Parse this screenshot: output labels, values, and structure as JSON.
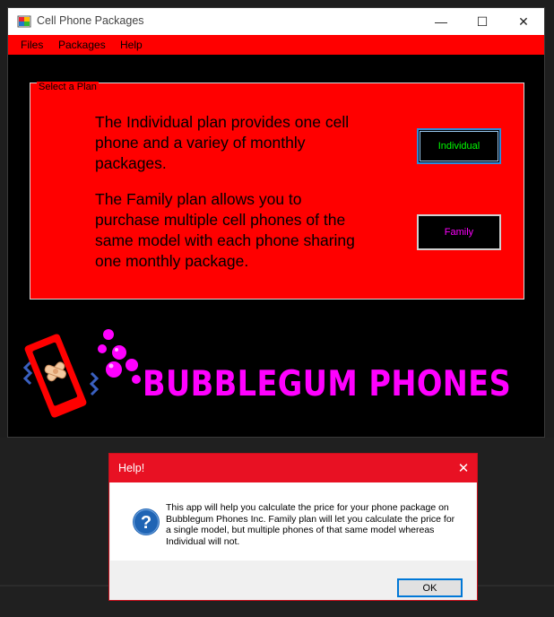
{
  "window": {
    "title": "Cell Phone Packages",
    "controls": {
      "minimize": "—",
      "maximize": "☐",
      "close": "✕"
    }
  },
  "menu": {
    "files": "Files",
    "packages": "Packages",
    "help": "Help"
  },
  "plan_group": {
    "label": "Select a Plan",
    "individual_text": "The Individual plan provides one cell phone and a variey of monthly packages.",
    "family_text": "The Family plan allows you to purchase multiple cell phones of the same model with each phone sharing one monthly package.",
    "individual_button": "Individual",
    "family_button": "Family"
  },
  "logo": {
    "brand": "BUBBLEGUM PHONES"
  },
  "dialog": {
    "title": "Help!",
    "close": "✕",
    "icon": "question-icon",
    "message": "This app will help you calculate the price for your phone package on Bubblegum Phones Inc. Family plan will let you calculate the price for a single model, but multiple phones of that same model whereas Individual will not.",
    "ok_button": "OK"
  },
  "colors": {
    "menu_bg": "#ff0000",
    "group_bg": "#ff0000",
    "individual_text": "#00ff00",
    "family_text": "#ff00ff",
    "brand": "#ff00ff",
    "dialog_titlebar": "#e81123"
  }
}
